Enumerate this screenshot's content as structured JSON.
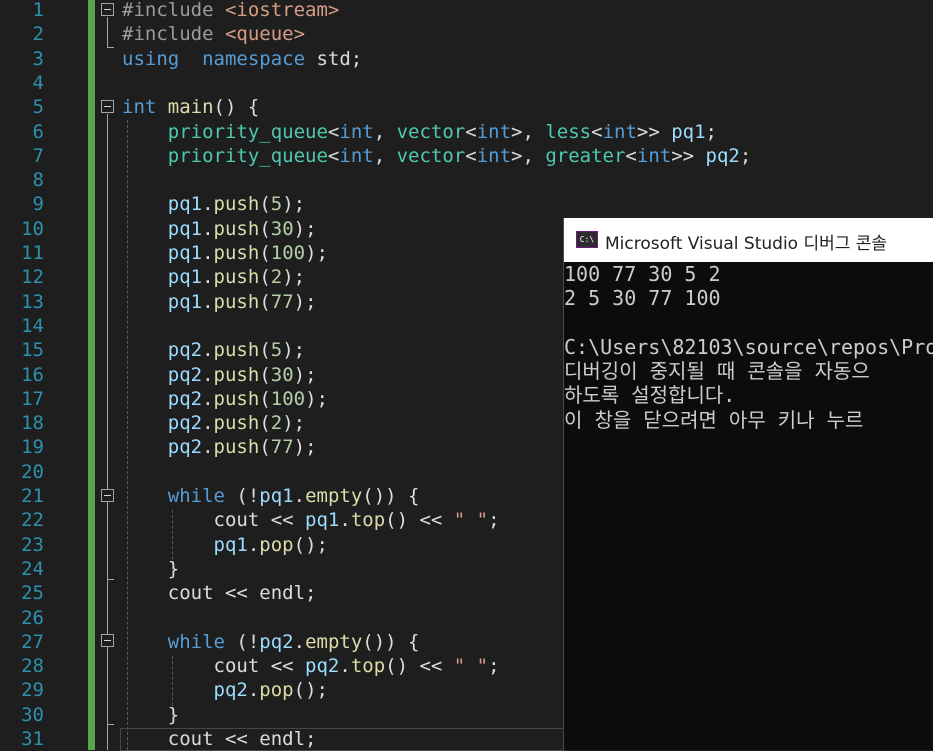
{
  "editor": {
    "line_numbers": [
      "1",
      "2",
      "3",
      "4",
      "5",
      "6",
      "7",
      "8",
      "9",
      "10",
      "11",
      "12",
      "13",
      "14",
      "15",
      "16",
      "17",
      "18",
      "19",
      "20",
      "21",
      "22",
      "23",
      "24",
      "25",
      "26",
      "27",
      "28",
      "29",
      "30",
      "31"
    ],
    "lines": [
      [
        [
          "pp",
          "#include "
        ],
        [
          "hdr",
          "<iostream>"
        ]
      ],
      [
        [
          "pp",
          "#include "
        ],
        [
          "hdr",
          "<queue>"
        ]
      ],
      [
        [
          "kw",
          "using"
        ],
        [
          "",
          "  "
        ],
        [
          "kw",
          "namespace"
        ],
        [
          "",
          " std;"
        ]
      ],
      [],
      [
        [
          "kw",
          "int"
        ],
        [
          "",
          " "
        ],
        [
          "fn",
          "main"
        ],
        [
          "",
          "() {"
        ]
      ],
      [
        [
          "",
          "    "
        ],
        [
          "tp",
          "priority_queue"
        ],
        [
          "",
          "<"
        ],
        [
          "kw",
          "int"
        ],
        [
          "",
          ", "
        ],
        [
          "tp",
          "vector"
        ],
        [
          "",
          "<"
        ],
        [
          "kw",
          "int"
        ],
        [
          "",
          ">, "
        ],
        [
          "tp",
          "less"
        ],
        [
          "",
          "<"
        ],
        [
          "kw",
          "int"
        ],
        [
          "",
          ">> "
        ],
        [
          "id",
          "pq1"
        ],
        [
          "",
          ";"
        ]
      ],
      [
        [
          "",
          "    "
        ],
        [
          "tp",
          "priority_queue"
        ],
        [
          "",
          "<"
        ],
        [
          "kw",
          "int"
        ],
        [
          "",
          ", "
        ],
        [
          "tp",
          "vector"
        ],
        [
          "",
          "<"
        ],
        [
          "kw",
          "int"
        ],
        [
          "",
          ">, "
        ],
        [
          "tp",
          "greater"
        ],
        [
          "",
          "<"
        ],
        [
          "kw",
          "int"
        ],
        [
          "",
          ">> "
        ],
        [
          "id",
          "pq2"
        ],
        [
          "",
          ";"
        ]
      ],
      [],
      [
        [
          "",
          "    "
        ],
        [
          "id",
          "pq1"
        ],
        [
          "",
          "."
        ],
        [
          "fn",
          "push"
        ],
        [
          "",
          "("
        ],
        [
          "nm",
          "5"
        ],
        [
          "",
          ");"
        ]
      ],
      [
        [
          "",
          "    "
        ],
        [
          "id",
          "pq1"
        ],
        [
          "",
          "."
        ],
        [
          "fn",
          "push"
        ],
        [
          "",
          "("
        ],
        [
          "nm",
          "30"
        ],
        [
          "",
          ");"
        ]
      ],
      [
        [
          "",
          "    "
        ],
        [
          "id",
          "pq1"
        ],
        [
          "",
          "."
        ],
        [
          "fn",
          "push"
        ],
        [
          "",
          "("
        ],
        [
          "nm",
          "100"
        ],
        [
          "",
          ");"
        ]
      ],
      [
        [
          "",
          "    "
        ],
        [
          "id",
          "pq1"
        ],
        [
          "",
          "."
        ],
        [
          "fn",
          "push"
        ],
        [
          "",
          "("
        ],
        [
          "nm",
          "2"
        ],
        [
          "",
          ");"
        ]
      ],
      [
        [
          "",
          "    "
        ],
        [
          "id",
          "pq1"
        ],
        [
          "",
          "."
        ],
        [
          "fn",
          "push"
        ],
        [
          "",
          "("
        ],
        [
          "nm",
          "77"
        ],
        [
          "",
          ");"
        ]
      ],
      [],
      [
        [
          "",
          "    "
        ],
        [
          "id",
          "pq2"
        ],
        [
          "",
          "."
        ],
        [
          "fn",
          "push"
        ],
        [
          "",
          "("
        ],
        [
          "nm",
          "5"
        ],
        [
          "",
          ");"
        ]
      ],
      [
        [
          "",
          "    "
        ],
        [
          "id",
          "pq2"
        ],
        [
          "",
          "."
        ],
        [
          "fn",
          "push"
        ],
        [
          "",
          "("
        ],
        [
          "nm",
          "30"
        ],
        [
          "",
          ");"
        ]
      ],
      [
        [
          "",
          "    "
        ],
        [
          "id",
          "pq2"
        ],
        [
          "",
          "."
        ],
        [
          "fn",
          "push"
        ],
        [
          "",
          "("
        ],
        [
          "nm",
          "100"
        ],
        [
          "",
          ");"
        ]
      ],
      [
        [
          "",
          "    "
        ],
        [
          "id",
          "pq2"
        ],
        [
          "",
          "."
        ],
        [
          "fn",
          "push"
        ],
        [
          "",
          "("
        ],
        [
          "nm",
          "2"
        ],
        [
          "",
          ");"
        ]
      ],
      [
        [
          "",
          "    "
        ],
        [
          "id",
          "pq2"
        ],
        [
          "",
          "."
        ],
        [
          "fn",
          "push"
        ],
        [
          "",
          "("
        ],
        [
          "nm",
          "77"
        ],
        [
          "",
          ");"
        ]
      ],
      [],
      [
        [
          "",
          "    "
        ],
        [
          "kw",
          "while"
        ],
        [
          "",
          " (!"
        ],
        [
          "id",
          "pq1"
        ],
        [
          "",
          "."
        ],
        [
          "fn",
          "empty"
        ],
        [
          "",
          "()) {"
        ]
      ],
      [
        [
          "",
          "        cout << "
        ],
        [
          "id",
          "pq1"
        ],
        [
          "",
          "."
        ],
        [
          "fn",
          "top"
        ],
        [
          "",
          "() << "
        ],
        [
          "st",
          "\" \""
        ],
        [
          "",
          ";"
        ]
      ],
      [
        [
          "",
          "        "
        ],
        [
          "id",
          "pq1"
        ],
        [
          "",
          "."
        ],
        [
          "fn",
          "pop"
        ],
        [
          "",
          "();"
        ]
      ],
      [
        [
          "",
          "    }"
        ]
      ],
      [
        [
          "",
          "    cout << endl;"
        ]
      ],
      [],
      [
        [
          "",
          "    "
        ],
        [
          "kw",
          "while"
        ],
        [
          "",
          " (!"
        ],
        [
          "id",
          "pq2"
        ],
        [
          "",
          "."
        ],
        [
          "fn",
          "empty"
        ],
        [
          "",
          "()) {"
        ]
      ],
      [
        [
          "",
          "        cout << "
        ],
        [
          "id",
          "pq2"
        ],
        [
          "",
          "."
        ],
        [
          "fn",
          "top"
        ],
        [
          "",
          "() << "
        ],
        [
          "st",
          "\" \""
        ],
        [
          "",
          ";"
        ]
      ],
      [
        [
          "",
          "        "
        ],
        [
          "id",
          "pq2"
        ],
        [
          "",
          "."
        ],
        [
          "fn",
          "pop"
        ],
        [
          "",
          "();"
        ]
      ],
      [
        [
          "",
          "    }"
        ]
      ],
      [
        [
          "",
          "    cout << endl;"
        ]
      ]
    ]
  },
  "console": {
    "icon_text": "C:\\",
    "title": "Microsoft Visual Studio 디버그 콘솔",
    "lines": [
      "100 77 30 5 2",
      "2 5 30 77 100",
      "",
      "C:\\Users\\82103\\source\\repos\\Pro",
      "디버깅이 중지될 때 콘솔을 자동으",
      "하도록 설정합니다.",
      "이 창을 닫으려면 아무 키나 누르"
    ]
  },
  "colors": {
    "background": "#1e1e1e",
    "line_number": "#2b91af",
    "keyword": "#569cd6",
    "type": "#4ec9b0",
    "function": "#dcdcaa",
    "variable": "#9cdcfe",
    "number": "#b5cea8",
    "string": "#d69d85",
    "change_bar": "#57a64a",
    "console_bg": "#0c0c0c"
  },
  "icons": {
    "fold_toggle": "collapse-minus-icon",
    "console_app": "console-app-icon"
  }
}
